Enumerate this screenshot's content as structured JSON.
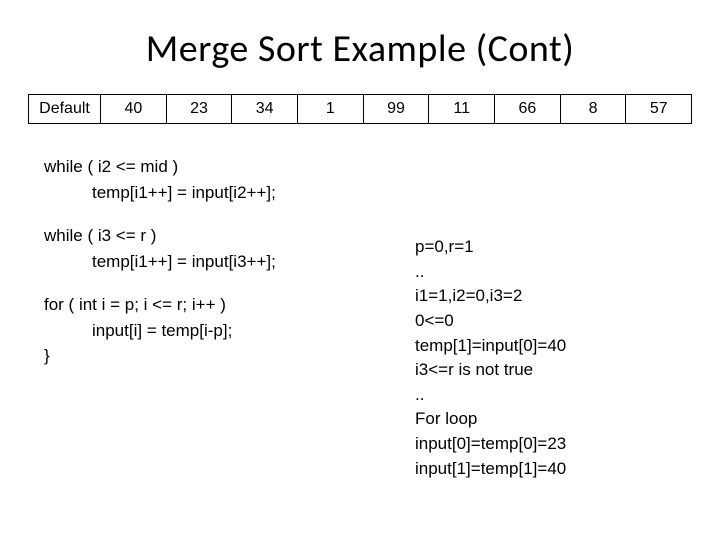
{
  "title": "Merge Sort Example (Cont)",
  "array": {
    "label": "Default",
    "cells": [
      "40",
      "23",
      "34",
      "1",
      "99",
      "11",
      "66",
      "8",
      "57"
    ]
  },
  "code": {
    "g1_l1": "while ( i2 <= mid )",
    "g1_l2": "temp[i1++] = input[i2++];",
    "g2_l1": "while ( i3 <= r )",
    "g2_l2": "temp[i1++] = input[i3++];",
    "g3_l1": "for ( int i = p; i <= r; i++ )",
    "g3_l2": "input[i] = temp[i-p];",
    "g3_l3": "}"
  },
  "trace": {
    "l1": "p=0,r=1",
    "l2": "..",
    "l3": "i1=1,i2=0,i3=2",
    "l4": "0<=0",
    "l5": "temp[1]=input[0]=40",
    "l6": "i3<=r is not true",
    "l7": "..",
    "l8": "For loop",
    "l9": "input[0]=temp[0]=23",
    "l10": "input[1]=temp[1]=40"
  }
}
